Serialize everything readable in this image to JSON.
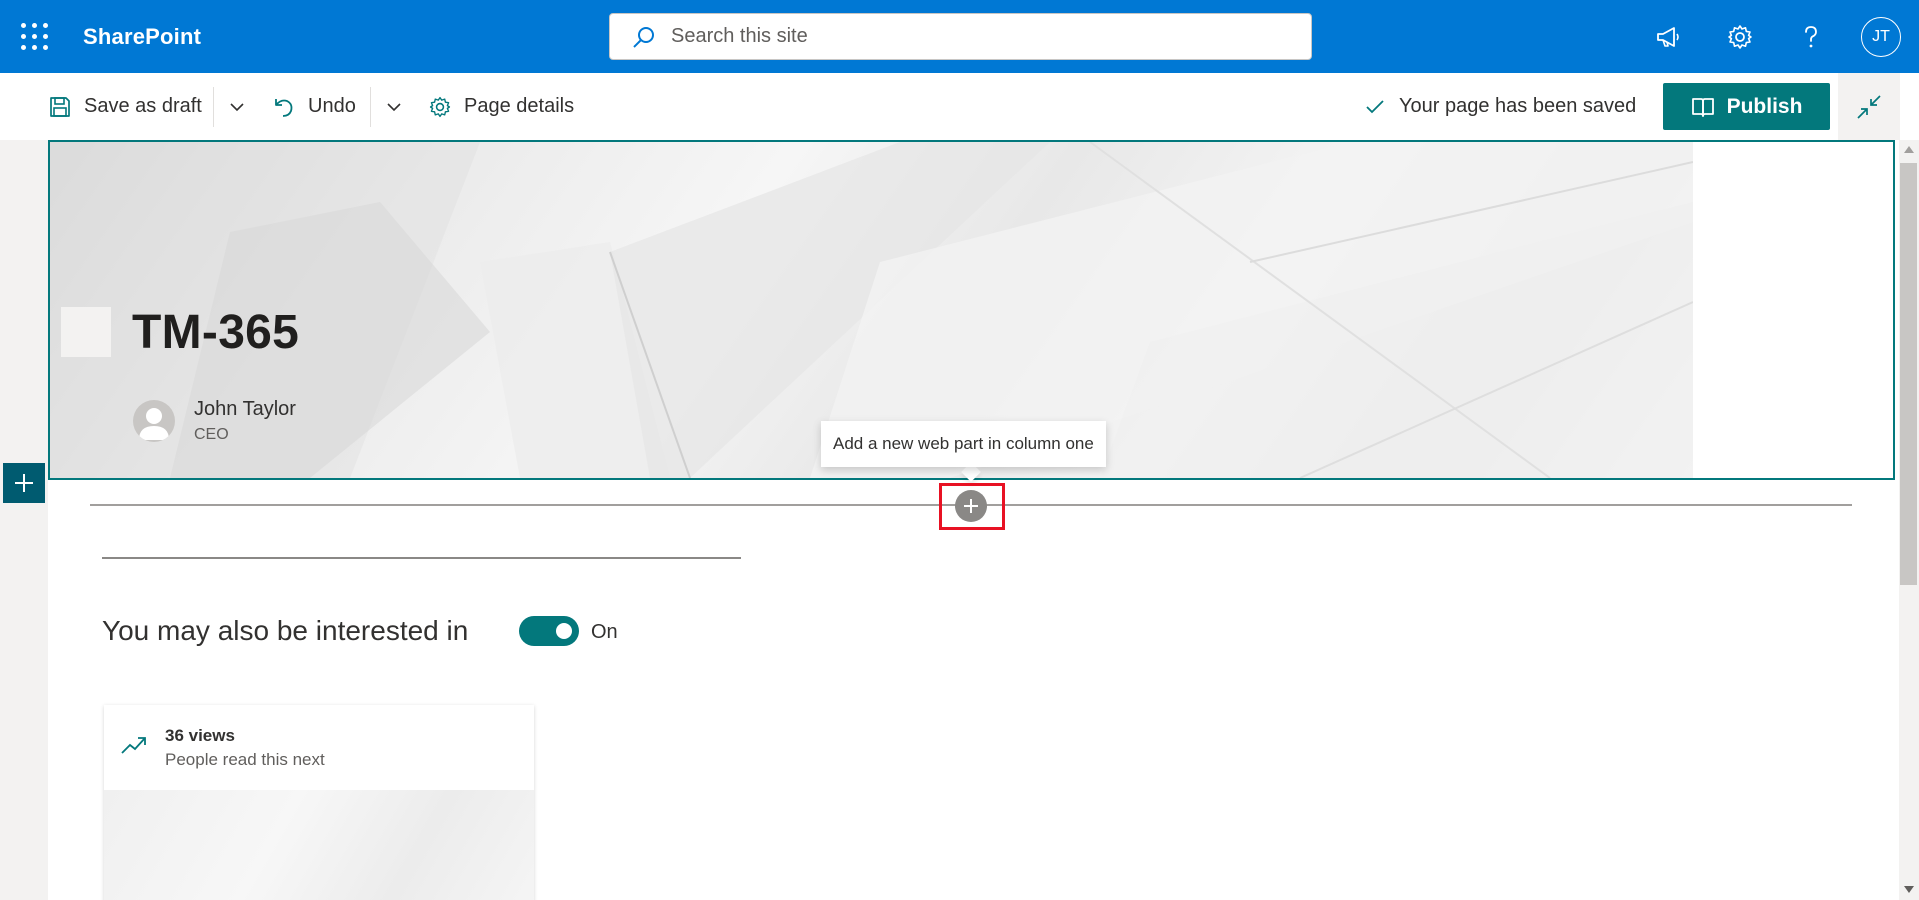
{
  "suite": {
    "brand": "SharePoint",
    "search_placeholder": "Search this site",
    "user_initials": "JT"
  },
  "command_bar": {
    "save_as_draft": "Save as draft",
    "undo": "Undo",
    "page_details": "Page details",
    "status": "Your page has been saved",
    "publish": "Publish"
  },
  "title_region": {
    "title": "TM-365",
    "author_name": "John Taylor",
    "author_role": "CEO"
  },
  "section": {
    "add_webpart_tooltip": "Add a new web part in column one"
  },
  "related": {
    "heading": "You may also be interested in",
    "toggle_state": "On",
    "card_views": "36 views",
    "card_subtitle": "People read this next"
  },
  "colors": {
    "suite_blue": "#0078d4",
    "theme_teal": "#03787c",
    "highlight_red": "#e81123"
  }
}
